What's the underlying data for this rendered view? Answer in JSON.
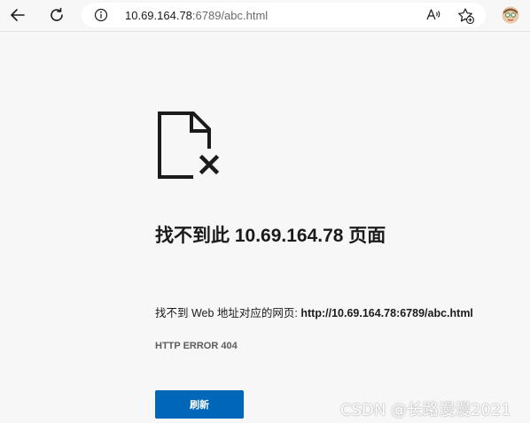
{
  "browser": {
    "url_host": "10.69.164.78",
    "url_rest": ":6789/abc.html"
  },
  "error": {
    "title": "找不到此 10.69.164.78 页面",
    "description_prefix": "找不到 Web 地址对应的网页: ",
    "description_url": "http://10.69.164.78:6789/abc.html",
    "code": "HTTP ERROR 404",
    "refresh_label": "刷新"
  },
  "watermark": "CSDN @长路漫漫2021",
  "colors": {
    "button": "#0067b8",
    "page_bg": "#f7f7f7"
  }
}
